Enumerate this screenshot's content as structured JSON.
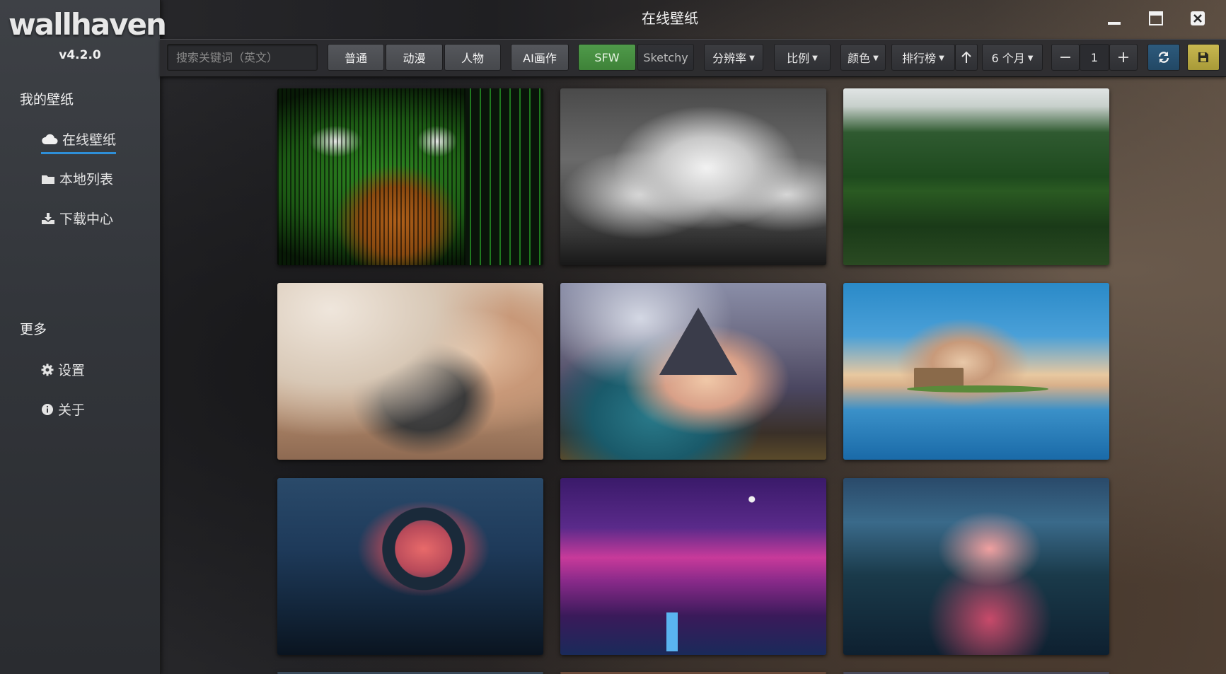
{
  "app": {
    "logo": "wallhaven",
    "version": "v4.2.0",
    "window_title": "在线壁纸"
  },
  "sidebar": {
    "my_wallpapers_title": "我的壁纸",
    "items": [
      {
        "label": "在线壁纸",
        "icon": "cloud-icon",
        "active": true
      },
      {
        "label": "本地列表",
        "icon": "folder-icon",
        "active": false
      },
      {
        "label": "下载中心",
        "icon": "download-icon",
        "active": false
      }
    ],
    "more_title": "更多",
    "more_items": [
      {
        "label": "设置",
        "icon": "gear-icon"
      },
      {
        "label": "关于",
        "icon": "info-icon"
      }
    ]
  },
  "toolbar": {
    "search_placeholder": "搜索关键词（英文）",
    "category_general": "普通",
    "category_anime": "动漫",
    "category_people": "人物",
    "ai_art": "AI画作",
    "purity_sfw": "SFW",
    "purity_sketchy": "Sketchy",
    "resolution": "分辨率",
    "ratio": "比例",
    "color": "颜色",
    "sort": "排行榜",
    "sort_order_icon": "arrow-up-icon",
    "time_range": "6 个月",
    "page_number": "1",
    "refresh_icon": "refresh-icon",
    "save_icon": "save-icon"
  },
  "colors": {
    "sfw_green": "#4a9445",
    "active_underline": "#2e8fd8",
    "refresh_blue": "#2d5a7c",
    "save_gold": "#c8b850"
  },
  "thumbnails": [
    {
      "subject": "ascii-pepe-matrix"
    },
    {
      "subject": "monochrome-clouds"
    },
    {
      "subject": "misty-forest-lake"
    },
    {
      "subject": "schoolgirl-skirt"
    },
    {
      "subject": "mountain-lake-tree"
    },
    {
      "subject": "island-house-reflection"
    },
    {
      "subject": "portal-ring-lake"
    },
    {
      "subject": "purple-mountains-night"
    },
    {
      "subject": "asian-river-village"
    }
  ]
}
